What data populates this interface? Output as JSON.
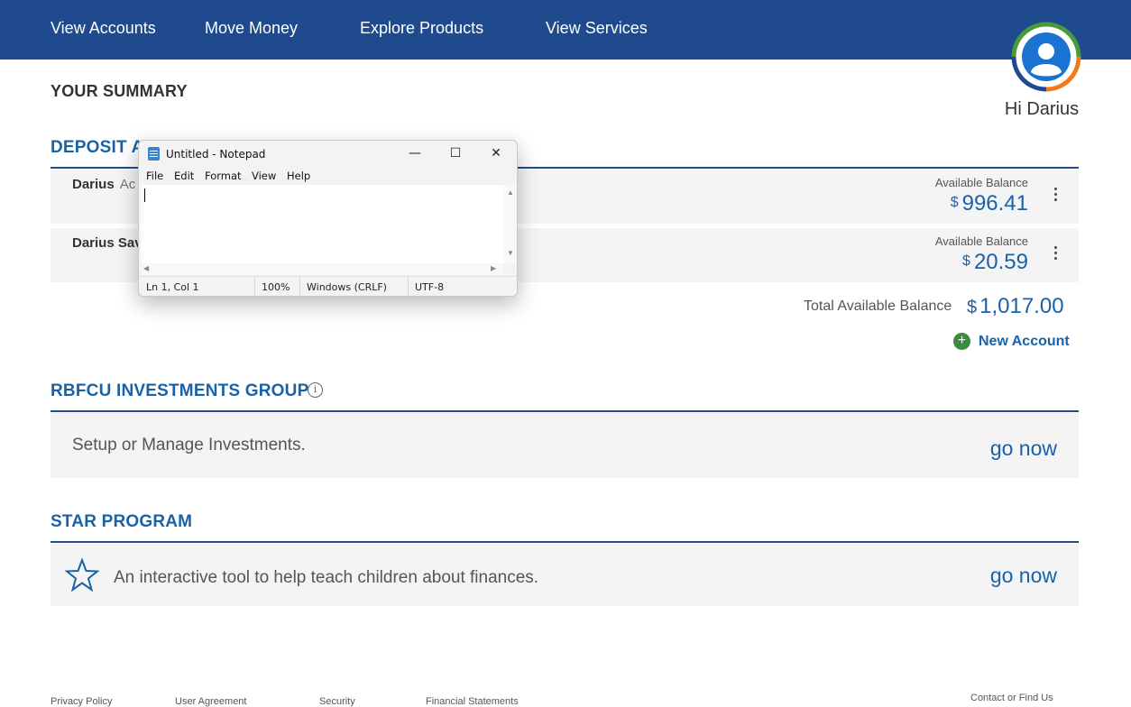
{
  "nav": {
    "items": [
      "View Accounts",
      "Move Money",
      "Explore Products",
      "View Services"
    ]
  },
  "user": {
    "greeting": "Hi Darius"
  },
  "summary": {
    "title": "YOUR SUMMARY"
  },
  "deposit": {
    "title": "DEPOSIT A",
    "accounts": [
      {
        "name": "Darius",
        "sub": "Ac",
        "balance_label": "Available Balance",
        "currency": "$",
        "balance": "996.41"
      },
      {
        "name": "Darius Sav",
        "sub": "",
        "balance_label": "Available Balance",
        "currency": "$",
        "balance": "20.59"
      }
    ],
    "total_label": "Total Available Balance",
    "total_currency": "$",
    "total_value": "1,017.00",
    "new_account": "New Account"
  },
  "investments": {
    "title": "RBFCU INVESTMENTS GROUP",
    "info_icon": "i",
    "text": "Setup or Manage Investments.",
    "link": "go now"
  },
  "star": {
    "title": "STAR PROGRAM",
    "text": "An interactive tool to help teach children about finances.",
    "link": "go now"
  },
  "footer": {
    "links": [
      "Privacy Policy",
      "User Agreement",
      "Security",
      "Financial Statements",
      "Contact or Find Us"
    ]
  },
  "notepad": {
    "title": "Untitled - Notepad",
    "controls": {
      "minimize": "—",
      "maximize": "☐",
      "close": "✕"
    },
    "menu": [
      "File",
      "Edit",
      "Format",
      "View",
      "Help"
    ],
    "content": "",
    "status": {
      "position": "Ln 1, Col 1",
      "zoom": "100%",
      "line_ending": "Windows (CRLF)",
      "encoding": "UTF-8"
    }
  },
  "colors": {
    "nav_bg": "#1f4b8e",
    "accent": "#1a62a8",
    "green": "#3a8a3f",
    "orange": "#f07a22"
  }
}
